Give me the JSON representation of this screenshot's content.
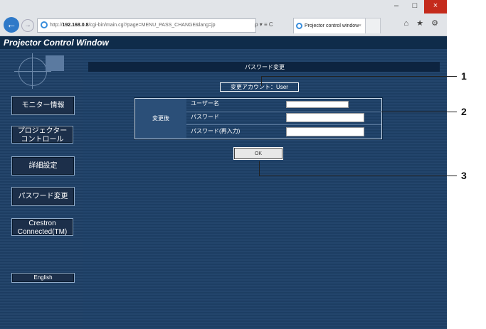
{
  "browser": {
    "url_prefix": "http://",
    "url_host": "192.168.0.8",
    "url_path": "/cgi-bin/main.cgi?page=MENU_PASS_CHANGE&lang=jp",
    "addr_tools": "ρ ▾ ≡ C",
    "tab_title": "Projector control window",
    "tab_close": "×",
    "win_min": "–",
    "win_max": "□",
    "win_close": "×",
    "nav_icons": "⌂ ★ ⚙",
    "back": "←",
    "forward": "→"
  },
  "app": {
    "header_title": "Projector Control Window"
  },
  "sidebar": {
    "items": [
      {
        "label": "モニター情報"
      },
      {
        "label": "プロジェクター\nコントロール"
      },
      {
        "label": "詳細設定"
      },
      {
        "label": "パスワード変更"
      },
      {
        "label": "Crestron\nConnected(TM)"
      },
      {
        "label": "English"
      }
    ]
  },
  "main": {
    "page_title": "パスワード変更",
    "account_label": "変更アカウント",
    "account_sep": "：",
    "account_value": "User",
    "form_section_label": "変更後",
    "fields": [
      {
        "label": "ユーザー名",
        "value": ""
      },
      {
        "label": "パスワード",
        "value": ""
      },
      {
        "label": "パスワード(再入力)",
        "value": ""
      }
    ],
    "ok_label": "OK"
  },
  "callouts": [
    "1",
    "2",
    "3"
  ]
}
